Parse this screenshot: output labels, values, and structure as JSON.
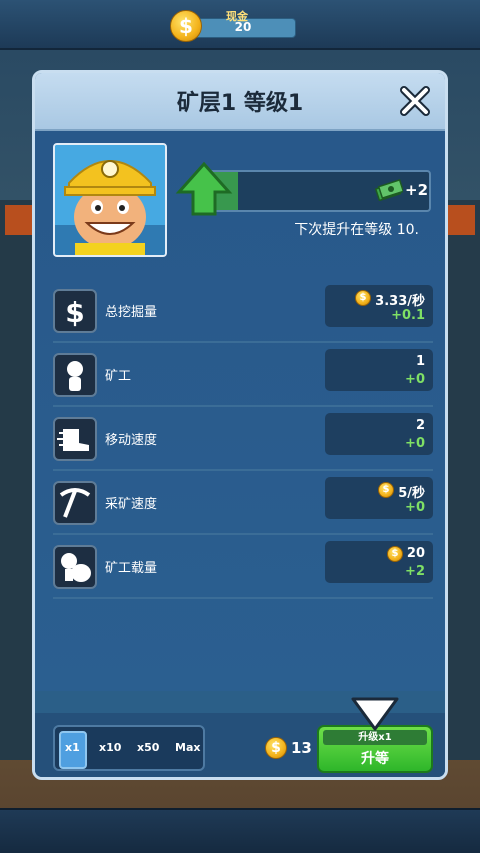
{
  "cash": {
    "label": "现金",
    "value": "20"
  },
  "dialog": {
    "title": "矿层1 等级1",
    "level_progress": 0.14,
    "level_gain": "+2",
    "next_level_text": "下次提升在等级 10."
  },
  "stats": [
    {
      "icon": "dollar-icon",
      "label": "总挖掘量",
      "value": "3.33/秒",
      "gain": "+0.1",
      "coin": true
    },
    {
      "icon": "miner-icon",
      "label": "矿工",
      "value": "1",
      "gain": "+0",
      "coin": false
    },
    {
      "icon": "boot-icon",
      "label": "移动速度",
      "value": "2",
      "gain": "+0",
      "coin": false
    },
    {
      "icon": "pickaxe-icon",
      "label": "采矿速度",
      "value": "5/秒",
      "gain": "+0",
      "coin": true
    },
    {
      "icon": "sack-icon",
      "label": "矿工载量",
      "value": "20",
      "gain": "+2",
      "coin": true
    }
  ],
  "multipliers": [
    "x1",
    "x10",
    "x50",
    "Max"
  ],
  "cost": "13",
  "upgrade": {
    "top_label": "升级x1",
    "label": "升等"
  },
  "colors": {
    "accent_green": "#2eb62a",
    "panel_blue": "#2b5f88",
    "gain_green": "#7fe065"
  }
}
